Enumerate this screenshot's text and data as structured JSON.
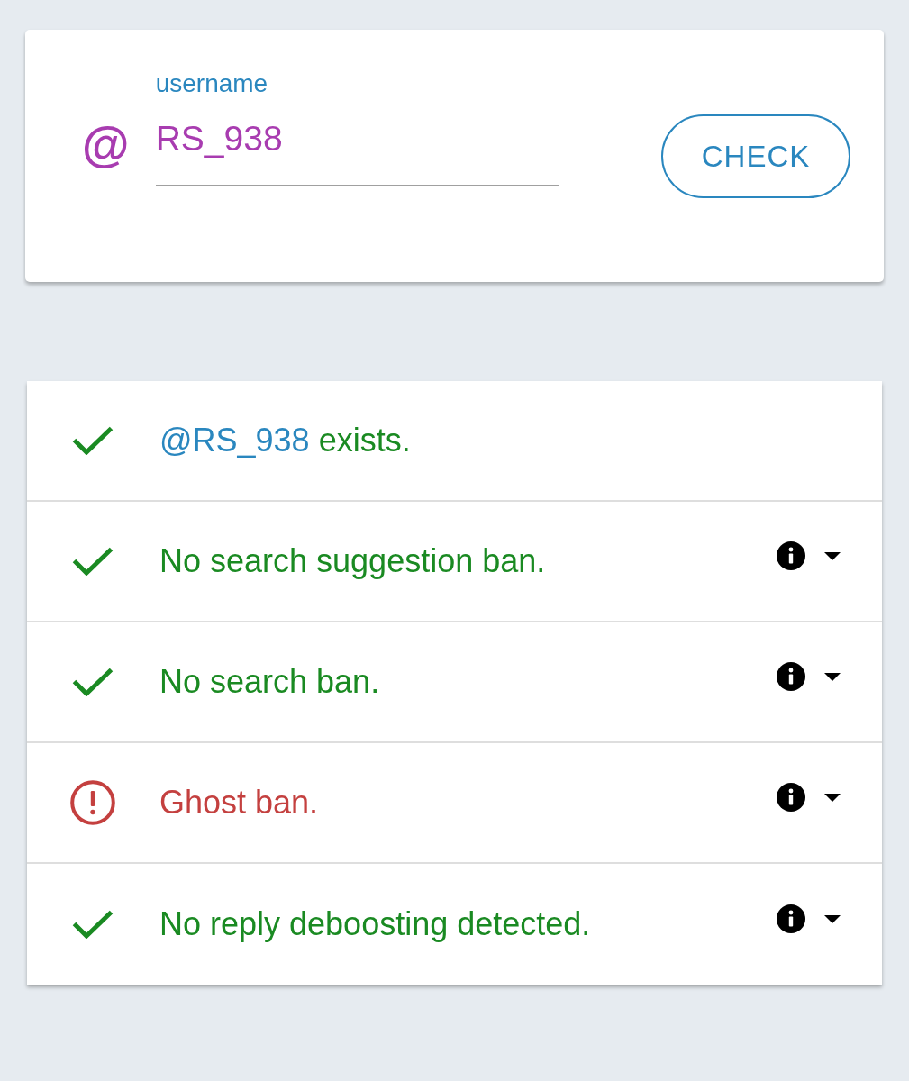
{
  "username_field": {
    "label": "username",
    "prefix": "@",
    "value": "RS_938"
  },
  "check_button": {
    "label": "CHECK"
  },
  "results": [
    {
      "kind": "pass",
      "link": "@RS_938",
      "text": "exists.",
      "expandable": false
    },
    {
      "kind": "pass",
      "text": "No search suggestion ban.",
      "expandable": true
    },
    {
      "kind": "pass",
      "text": "No search ban.",
      "expandable": true
    },
    {
      "kind": "fail",
      "text": "Ghost ban.",
      "expandable": true
    },
    {
      "kind": "pass",
      "text": "No reply deboosting detected.",
      "expandable": true
    }
  ]
}
